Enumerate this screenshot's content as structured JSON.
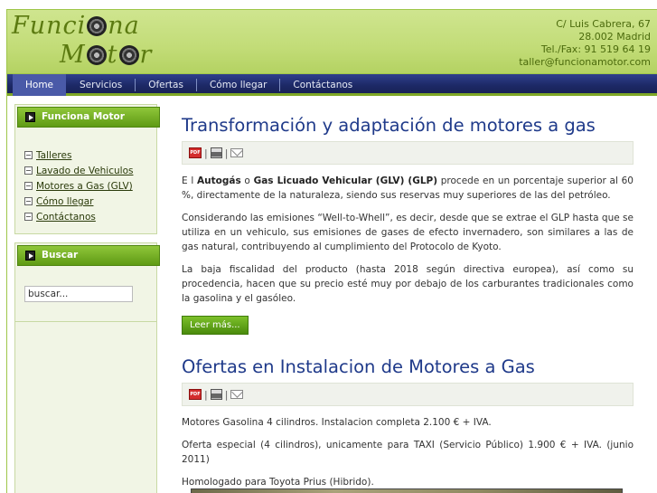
{
  "header": {
    "logo_line1_a": "Funci",
    "logo_line1_b": "na",
    "logo_line2_a": "M",
    "logo_line2_b": "t",
    "logo_line2_c": "r",
    "contact": [
      "C/ Luis Cabrera, 67",
      "28.002 Madrid",
      "Tel./Fax: 91 519 64 19",
      "taller@funcionamotor.com"
    ]
  },
  "nav": {
    "items": [
      {
        "label": "Home",
        "active": true
      },
      {
        "label": "Servicios"
      },
      {
        "label": "Ofertas"
      },
      {
        "label": "Cómo llegar"
      },
      {
        "label": "Contáctanos"
      }
    ]
  },
  "sidebar": {
    "menu_title": "Funciona Motor",
    "menu_items": [
      "Talleres",
      "Lavado de Vehiculos",
      "Motores a Gas (GLV)",
      "Cómo llegar",
      "Contáctanos"
    ],
    "search_title": "Buscar",
    "search_value": "buscar..."
  },
  "articles": [
    {
      "title": "Transformación y adaptación de motores a gas",
      "p1_a": "E l ",
      "p1_b": "Autogás",
      "p1_c": "  o ",
      "p1_d": "Gas Licuado Vehicular (GLV) (GLP)",
      "p1_e": " procede en un porcentaje superior al 60 %, directamente de la naturaleza, siendo sus reservas muy superiores de las del petróleo.",
      "p2": "Considerando las emisiones “Well-to-Whell”, es decir, desde que se extrae el GLP hasta que se utiliza en un vehiculo, sus emisiones de gases de efecto invernadero, son similares a las de gas natural, contribuyendo al cumplimiento del Protocolo de Kyoto.",
      "p3": "La baja fiscalidad del producto (hasta 2018 según directiva europea), así como su procedencia, hacen que su precio esté muy por debajo de los carburantes tradicionales como la gasolina y el gasóleo.",
      "readmore": "Leer más..."
    },
    {
      "title": "Ofertas en Instalacion de Motores a Gas",
      "p1": "Motores Gasolina 4 cilindros.  Instalacion completa 2.100 € + IVA.",
      "p2": "Oferta especial (4 cilindros), unicamente para TAXI (Servicio Público) 1.900 € + IVA. (junio 2011)",
      "p3": "Homologado para Toyota Prius (Hibrido)."
    }
  ],
  "toolbar": {
    "sep": "|",
    "pdf_label": "PDF"
  }
}
